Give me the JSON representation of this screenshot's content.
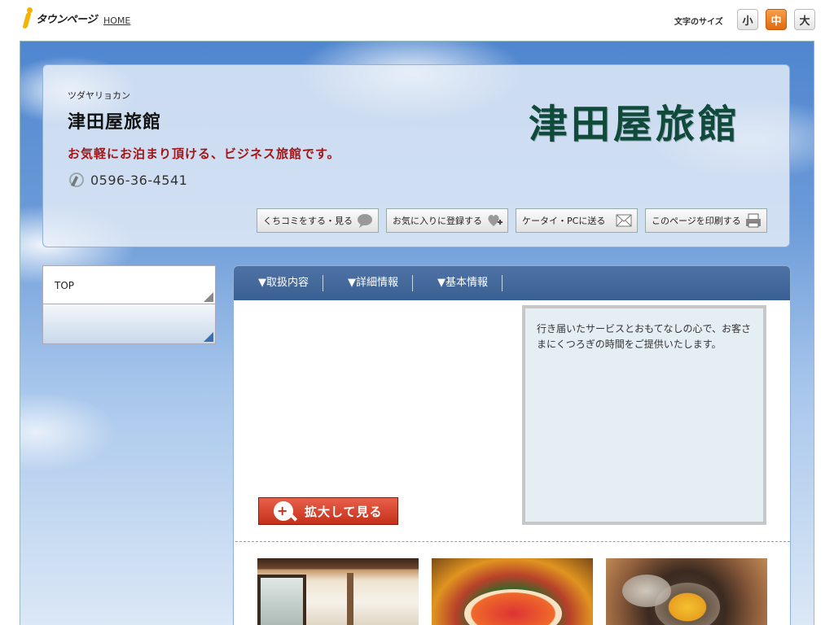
{
  "topbar": {
    "logo_text": "タウンページ",
    "home_link": "HOME",
    "font_size_label": "文字のサイズ",
    "font_sizes": [
      {
        "label": "小",
        "active": false
      },
      {
        "label": "中",
        "active": true
      },
      {
        "label": "大",
        "active": false
      }
    ]
  },
  "header": {
    "kana": "ツダヤリョカン",
    "name": "津田屋旅館",
    "catchphrase": "お気軽にお泊まり頂ける、ビジネス旅館です。",
    "phone": "0596-36-4541",
    "brand_title": "津田屋旅館",
    "actions": [
      {
        "label": "くちコミをする・見る",
        "icon": "speech-bubble-icon"
      },
      {
        "label": "お気に入りに登録する",
        "icon": "heart-plus-icon"
      },
      {
        "label": "ケータイ・PCに送る",
        "icon": "mail-icon"
      },
      {
        "label": "このページを印刷する",
        "icon": "printer-icon"
      }
    ]
  },
  "sidebar": {
    "top_label": "TOP"
  },
  "main": {
    "tabs": [
      "▼取扱内容",
      "▼詳細情報",
      "▼基本情報"
    ],
    "zoom_button": "拡大して見る",
    "description": "行き届いたサービスとおもてなしの心で、お客さまにくつろぎの時間をご提供いたします。"
  },
  "colors": {
    "accent_red": "#a01616",
    "tab_blue": "#3a5f92",
    "brand_green": "#0f4a3a",
    "active_orange": "#e06a10"
  }
}
